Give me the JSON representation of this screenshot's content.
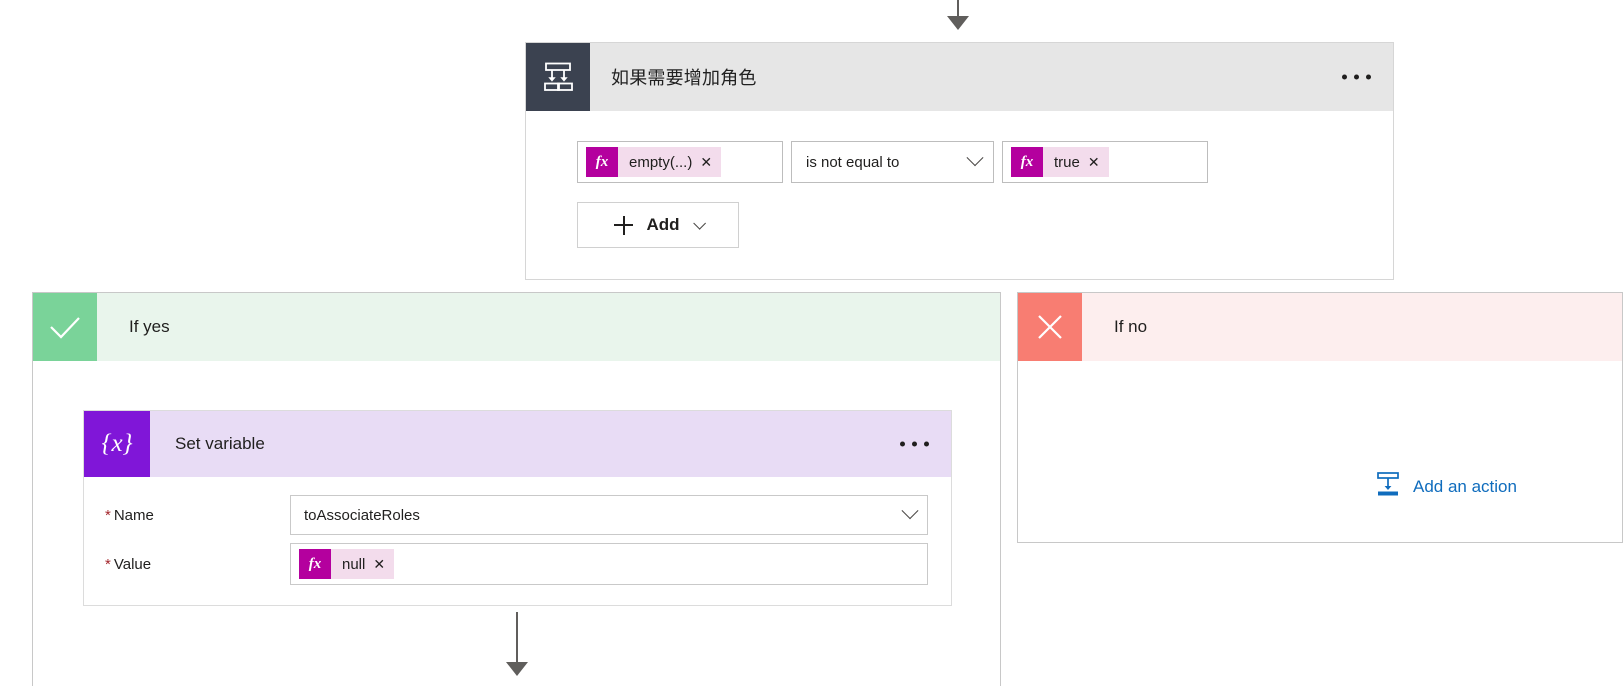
{
  "flow": {
    "condition_card": {
      "title": "如果需要增加角色",
      "icon": "condition-branch-icon",
      "overflow_menu": "...",
      "condition": {
        "left_operand": {
          "icon": "fx-icon",
          "label": "empty(...)",
          "remove": "✕"
        },
        "operator": {
          "value": "is not equal to",
          "chevron": "chevron-down-icon"
        },
        "right_operand": {
          "icon": "fx-icon",
          "label": "true",
          "remove": "✕"
        }
      },
      "add_button": {
        "label": "Add",
        "plus": "plus-icon",
        "chevron": "chevron-down-icon"
      }
    },
    "branch_yes": {
      "label": "If yes",
      "badge_icon": "checkmark-icon",
      "badge_color": "#7ad399",
      "header_color": "#e9f5ec",
      "action_card": {
        "title": "Set variable",
        "icon": "set-variable-icon",
        "icon_glyph": "{x}",
        "icon_color": "#8016d8",
        "header_color": "#e8dcf5",
        "overflow_menu": "...",
        "fields": [
          {
            "required": "*",
            "label": "Name",
            "value": "toAssociateRoles",
            "control": "dropdown",
            "chevron": "chevron-down-icon"
          },
          {
            "required": "*",
            "label": "Value",
            "token": {
              "icon": "fx-icon",
              "label": "null",
              "remove": "✕"
            },
            "control": "token-input"
          }
        ]
      }
    },
    "branch_no": {
      "label": "If no",
      "badge_icon": "close-icon",
      "badge_color": "#f87d72",
      "header_color": "#fdeeee",
      "add_action": {
        "label": "Add an action",
        "icon": "insert-action-icon",
        "color": "#0f6cbd"
      }
    },
    "colors": {
      "condition_icon_bg": "#3b4250",
      "card_header_bg": "#e6e6e6",
      "fx_accent": "#b4009e",
      "fx_token_bg": "#f3dcec",
      "connector": "#605e5c"
    }
  }
}
